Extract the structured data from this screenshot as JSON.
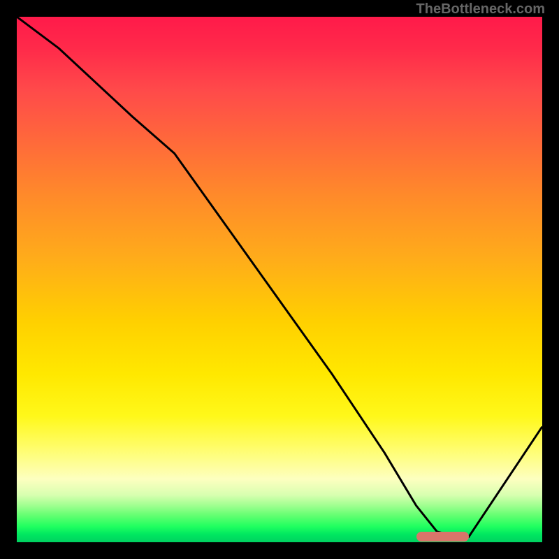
{
  "watermark": "TheBottleneck.com",
  "chart_data": {
    "type": "line",
    "title": "",
    "xlabel": "",
    "ylabel": "",
    "xlim": [
      0,
      100
    ],
    "ylim": [
      0,
      100
    ],
    "series": [
      {
        "name": "main-curve",
        "x": [
          0,
          8,
          22,
          30,
          40,
          50,
          60,
          70,
          76,
          80,
          84,
          86,
          100
        ],
        "y": [
          100,
          94,
          81,
          74,
          60,
          46,
          32,
          17,
          7,
          2,
          1,
          1,
          22
        ]
      }
    ],
    "optimum_marker": {
      "x_start": 76,
      "x_end": 86,
      "y": 1
    },
    "gradient_stops": [
      {
        "pct": 0,
        "color": "#ff1a4a"
      },
      {
        "pct": 50,
        "color": "#ffcc00"
      },
      {
        "pct": 85,
        "color": "#ffff80"
      },
      {
        "pct": 100,
        "color": "#00d060"
      }
    ]
  }
}
